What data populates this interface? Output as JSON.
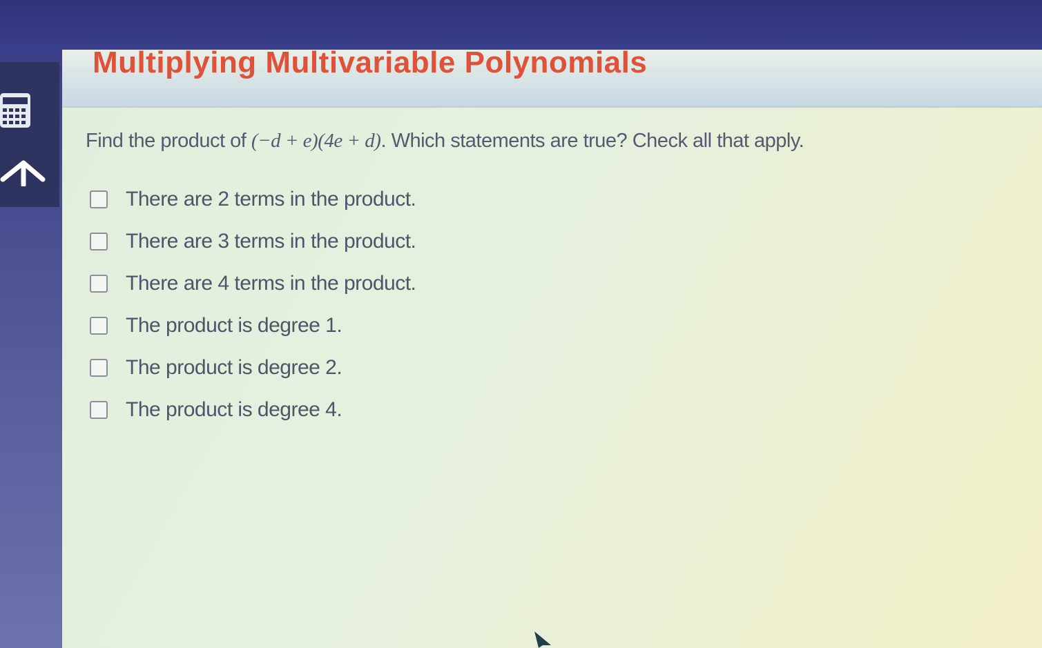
{
  "header": {
    "title": "Multiplying Multivariable Polynomials"
  },
  "sidebar": {
    "icons": [
      "calculator-icon",
      "back-arrow-icon"
    ]
  },
  "question": {
    "prefix": "Find the product of ",
    "expression": "(−d + e)(4e + d)",
    "suffix": ". Which statements are true? Check all that apply."
  },
  "options": [
    {
      "label": "There are 2 terms in the product.",
      "checked": false
    },
    {
      "label": "There are 3 terms in the product.",
      "checked": false
    },
    {
      "label": "There are 4 terms in the product.",
      "checked": false
    },
    {
      "label": "The product is degree 1.",
      "checked": false
    },
    {
      "label": "The product is degree 2.",
      "checked": false
    },
    {
      "label": "The product is degree 4.",
      "checked": false
    }
  ],
  "colors": {
    "title": "#e0513a",
    "text": "#4f5468",
    "sidebar": "#3b3f86"
  }
}
